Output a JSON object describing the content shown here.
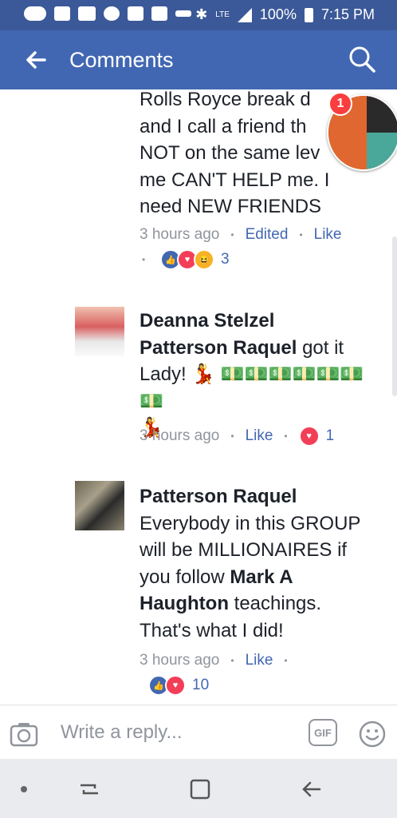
{
  "status_bar": {
    "battery": "100%",
    "time": "7:15 PM",
    "network": "LTE"
  },
  "app_bar": {
    "title": "Comments"
  },
  "comments": [
    {
      "text_lines": [
        "Rolls Royce break d",
        "and I call a friend th",
        "NOT on the same lev",
        "me CAN'T HELP me. I",
        "need NEW FRIENDS"
      ],
      "time": "3 hours ago",
      "edited": "Edited",
      "like": "Like",
      "reaction_count": "3"
    },
    {
      "author_line1": "Deanna Stelzel",
      "author_line2": "Patterson Raquel",
      "text_after": "got it",
      "text_line3": "Lady! 💃 💵💵💵💵💵💵💵",
      "text_line4": "💃",
      "time": "3 hours ago",
      "like": "Like",
      "reaction_count": "1"
    },
    {
      "author": "Patterson Raquel",
      "text_line1": "Everybody in this GROUP",
      "text_line2": "will be MILLIONAIRES if",
      "text_line3_pre": "you follow",
      "text_line3_bold": "Mark A",
      "text_line4_bold": "Haughton",
      "text_line4_post": "teachings.",
      "text_line5": "That's what I did!",
      "time": "3 hours ago",
      "like": "Like",
      "reaction_count": "10"
    }
  ],
  "chat_head": {
    "badge": "1"
  },
  "reply": {
    "placeholder": "Write a reply..."
  },
  "colors": {
    "brand": "#4267b2",
    "status": "#3b5998",
    "like_blue": "#4267b2",
    "love_red": "#f33e58",
    "haha_yellow": "#f7b125"
  }
}
